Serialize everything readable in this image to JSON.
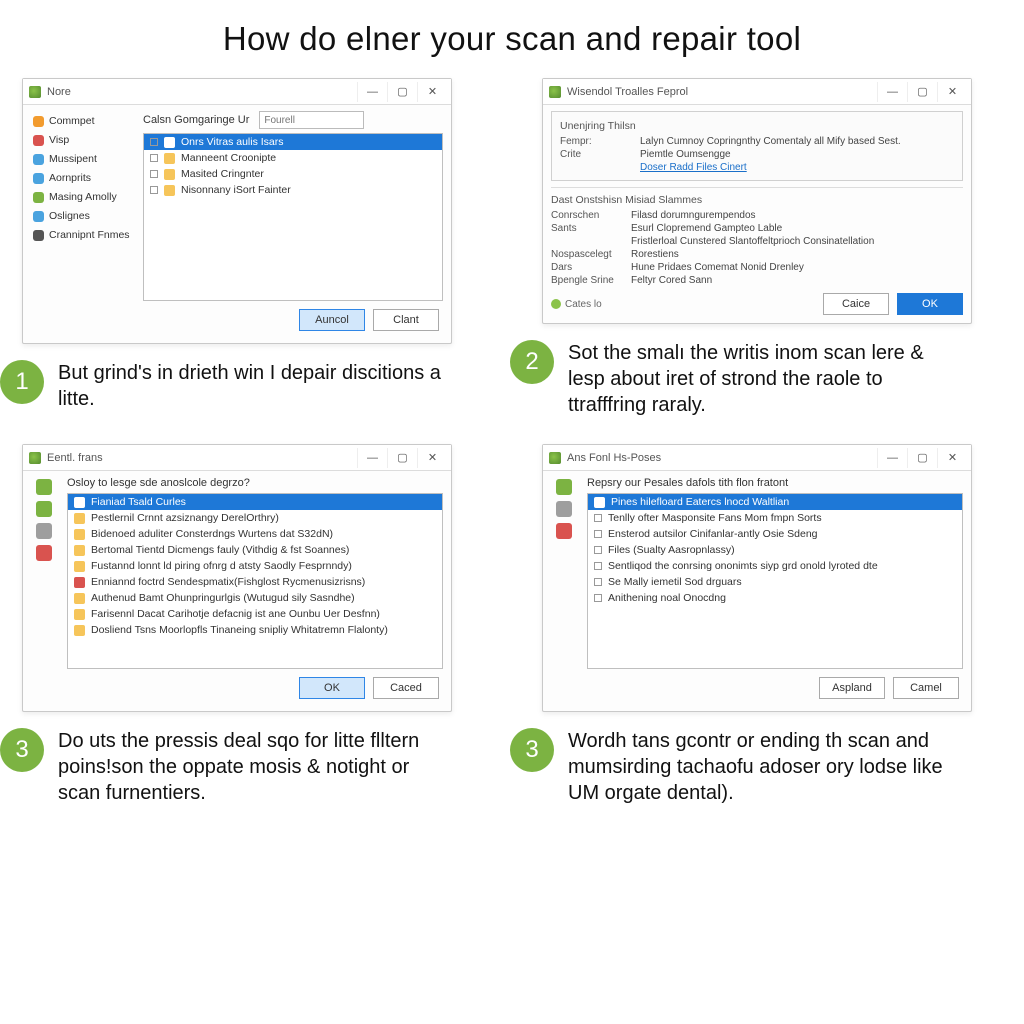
{
  "title": "How do elner your scan and repair tool",
  "colors": {
    "accent_blue": "#1e78d7",
    "badge_green": "#7cb342"
  },
  "step1": {
    "window_title": "Nore",
    "sidebar": [
      {
        "label": "Commpet",
        "icon": "ico-orange"
      },
      {
        "label": "Visp",
        "icon": "ico-red"
      },
      {
        "label": "Mussipent",
        "icon": "ico-blue"
      },
      {
        "label": "Aornprits",
        "icon": "ico-blue"
      },
      {
        "label": "Masing Amolly",
        "icon": "ico-green"
      },
      {
        "label": "Oslignes",
        "icon": "ico-blue"
      },
      {
        "label": "Crannipnt Fnmes",
        "icon": "ico-darkgray"
      }
    ],
    "pane_label": "Calsn Gomgaringe Ur",
    "search_placeholder": "Fourell",
    "rows": [
      "Onrs Vitras aulis Isars",
      "Manneent Croonipte",
      "Masited Cringnter",
      "Nisonnany iSort Fainter"
    ],
    "buttons": {
      "ok": "Auncol",
      "cancel": "Clant"
    },
    "badge": "1",
    "caption": "But grind's in drieth win I depair discitions a litte."
  },
  "step2": {
    "window_title": "Wisendol Troalles Feprol",
    "section1_title": "Unenjring Thilsn",
    "section1_rows": [
      {
        "k": "Fempr:",
        "v": "Lalyn Cumnoy Copringnthy Comentaly all Mify based Sest."
      },
      {
        "k": "Crite",
        "v": "Piemtle Oumsengge"
      }
    ],
    "section1_links": "Doser Radd Files   Cinert",
    "section2_title": "Dast Onstshisn Misiad Slammes",
    "section2_rows": [
      {
        "k": "Conrschen",
        "v": "Filasd dorumngurempendos"
      },
      {
        "k": "Sants",
        "v": "Esurl Clopremend Gampteo Lable"
      },
      {
        "k": "",
        "v": "Fristlerloal Cunstered Slantoffeltprioch Consinatellation"
      },
      {
        "k": "Nospascelegt",
        "v": "Rorestiens"
      },
      {
        "k": "Dars",
        "v": "Hune Pridaes Comemat Nonid Drenley"
      },
      {
        "k": "Bpengle Srine",
        "v": "Feltyr Cored Sann"
      }
    ],
    "footer_hint": "Cates lo",
    "buttons": {
      "cancel": "Caice",
      "ok": "OK"
    },
    "badge": "2",
    "caption": "Sot the smalı the writis inom scan lere & lesp about iret of strond the raole to ttrafffring raraly."
  },
  "step3": {
    "window_title": "Eentl. frans",
    "prompt": "Osloy to lesge sde anoslcole degrzo?",
    "rows": [
      "Fianiad Tsald Curles",
      "Pestlernil Crnnt azsiznangy DerelOrthry)",
      "Bidenoed aduliter Consterdngs Wurtens dat S32dN)",
      "Bertomal Tientd Dicmengs fauly (Vithdig & fst Soannes)",
      "Fustannd lonnt ld piring ofnrg d atsty Saodly Fesprnndy)",
      "Enniannd foctrd Sendespmatix(Fishglost Rycmenusizrisns)",
      "Authenud Bamt Ohunpringurlgis (Wutugud sily Sasndhe)",
      "Farisennl Dacat Carihotje defacnig ist ane Ounbu Uer Desfnn)",
      "Dosliend Tsns Moorlopfls Tinaneing snipliy Whitatremn Flalonty)"
    ],
    "buttons": {
      "ok": "OK",
      "cancel": "Caced"
    },
    "badge": "3",
    "caption": "Do uts the pressis deal sqo for litte flltern poins!son the oppate mosis & notight or scan furnentiers."
  },
  "step4": {
    "window_title": "Ans Fonl Hs-Poses",
    "prompt": "Repsry our Pesales dafols tith flon fratont",
    "rows": [
      "Pines hilefloard Eatercs lnocd Waltlian",
      "Tenlly ofter Masponsite Fans Mom fmpn Sorts",
      "Ensterod autsilor Cinifanlar-antly Osie Sdeng",
      "Files (Sualty Aasropnlassy)",
      "Sentliqod the conrsing ononimts siyp grd onold lyroted dte",
      "Se Mally iemetil Sod drguars",
      "Anithening noal Onocdng"
    ],
    "buttons": {
      "ok": "Aspland",
      "cancel": "Camel"
    },
    "badge": "3",
    "caption": "Wordh tans gcontr or ending th scan and mumsirding tachaofu adoser ory lodse like UM orgate dental)."
  }
}
